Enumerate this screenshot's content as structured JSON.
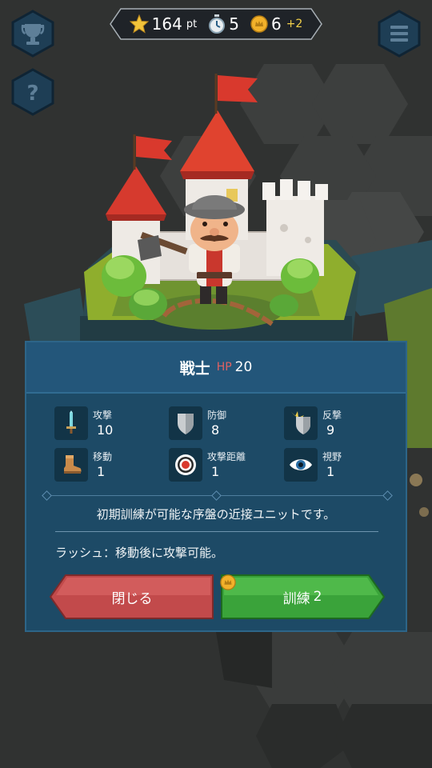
{
  "hud": {
    "score": "164",
    "score_unit": "pt",
    "turns": "5",
    "coins": "6",
    "coin_bonus": "+2"
  },
  "unit": {
    "name": "戦士",
    "hp_label": "HP",
    "hp_value": "20"
  },
  "stats": [
    {
      "label": "攻撃",
      "value": "10",
      "icon": "sword-icon"
    },
    {
      "label": "防御",
      "value": "8",
      "icon": "shield-icon"
    },
    {
      "label": "反撃",
      "value": "9",
      "icon": "counter-shield-icon"
    },
    {
      "label": "移動",
      "value": "1",
      "icon": "boot-icon"
    },
    {
      "label": "攻撃距離",
      "value": "1",
      "icon": "target-icon"
    },
    {
      "label": "視野",
      "value": "1",
      "icon": "eye-icon"
    }
  ],
  "description": "初期訓練が可能な序盤の近接ユニットです。",
  "ability": "ラッシュ：移動後に攻撃可能。",
  "buttons": {
    "close_label": "閉じる",
    "train_label": "訓練",
    "train_cost": "2"
  },
  "colors": {
    "close_button": "#c24a4b",
    "train_button": "#3aa33a",
    "dialog_bg": "#1d4a66",
    "hp_label": "#e06262",
    "coin": "#f2b12a"
  }
}
